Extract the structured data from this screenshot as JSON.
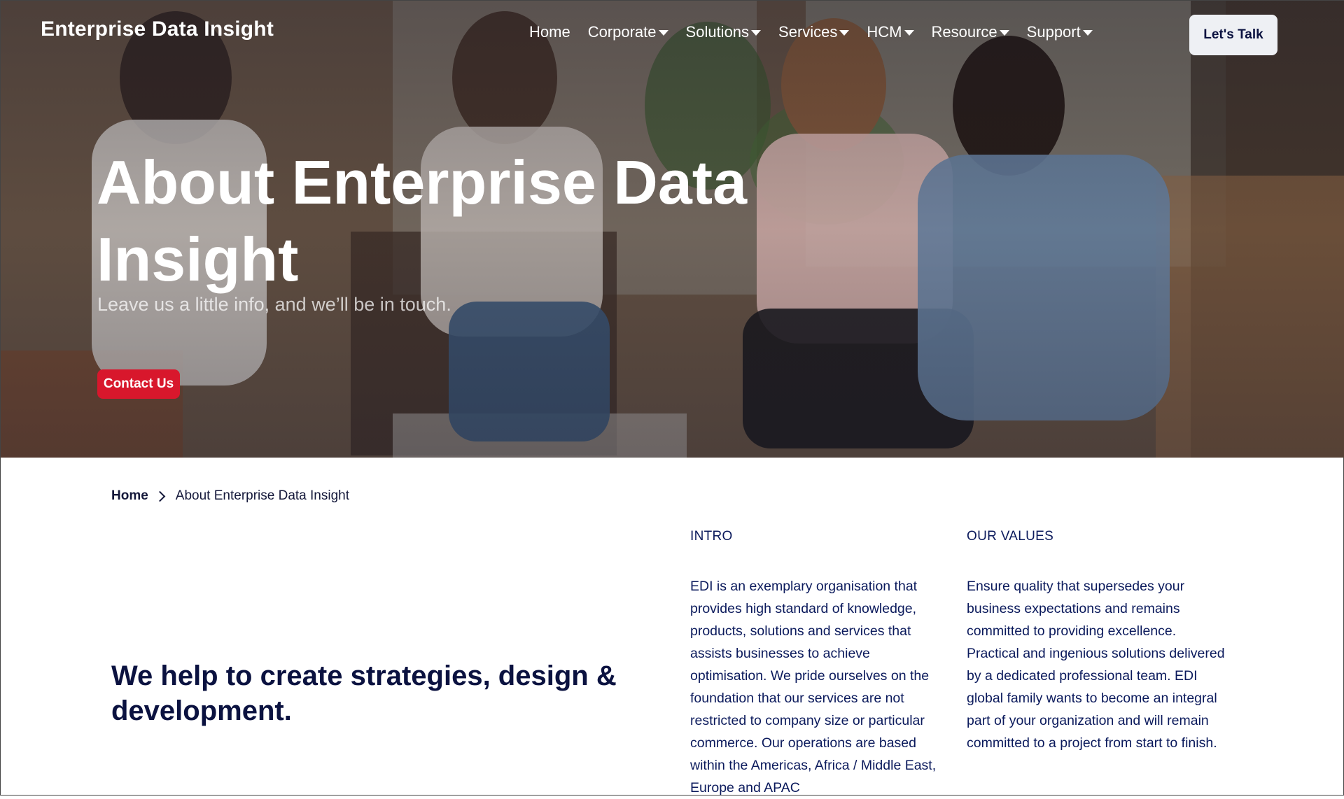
{
  "header": {
    "brand": "Enterprise Data Insight",
    "nav": [
      {
        "label": "Home",
        "has_dropdown": false
      },
      {
        "label": "Corporate",
        "has_dropdown": true
      },
      {
        "label": "Solutions",
        "has_dropdown": true
      },
      {
        "label": "Services",
        "has_dropdown": true
      },
      {
        "label": "HCM",
        "has_dropdown": true
      },
      {
        "label": "Resource",
        "has_dropdown": true
      },
      {
        "label": "Support",
        "has_dropdown": true
      }
    ],
    "cta_label": "Let's Talk"
  },
  "hero": {
    "title": "About Enterprise Data Insight",
    "subtitle": "Leave us a little info, and we’ll be in touch.",
    "button_label": "Contact Us"
  },
  "breadcrumb": {
    "home": "Home",
    "current": "About Enterprise Data Insight"
  },
  "main": {
    "tagline": "We help to create strategies, design & development.",
    "intro": {
      "heading": "INTRO",
      "text": "EDI is an exemplary organisation that provides high standard of knowledge, products, solutions and services that assists businesses to achieve optimisation. We pride ourselves on the foundation that our services are not restricted to company size or particular commerce. Our operations are based within the Americas, Africa / Middle East, Europe and APAC"
    },
    "values": {
      "heading": "OUR VALUES",
      "text": "Ensure quality that supersedes your business expectations and remains committed to providing excellence. Practical and ingenious solutions delivered by a dedicated professional team. EDI global family wants to become an integral part of your organization and will remain committed to a project from start to finish."
    }
  },
  "colors": {
    "accent_red": "#d8172c",
    "navy_text": "#0b1240",
    "body_text": "#0b1a5c"
  }
}
